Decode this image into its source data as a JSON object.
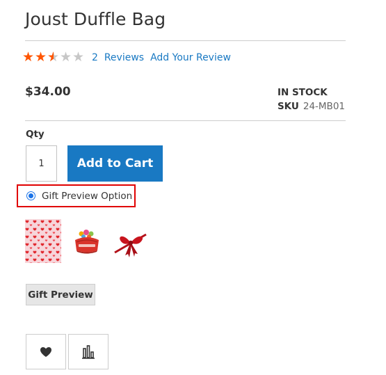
{
  "product": {
    "title": "Joust Duffle Bag",
    "price": "$34.00",
    "stock_status": "IN STOCK",
    "sku_label": "SKU",
    "sku_value": "24-MB01"
  },
  "rating": {
    "value": 2.5,
    "max": 5,
    "review_count_label": "2",
    "reviews_label": "Reviews",
    "add_review_label": "Add Your Review",
    "colors": {
      "filled": "#ff5501",
      "empty": "#c7c7c7",
      "link": "#1979c3"
    }
  },
  "purchase": {
    "qty_label": "Qty",
    "qty_value": "1",
    "add_to_cart_label": "Add to Cart",
    "button_color": "#1979c3"
  },
  "gift": {
    "option_label": "Gift Preview Option",
    "option_selected": true,
    "highlight_color": "#e00000",
    "thumbnails": [
      {
        "icon": "heart-pattern-wrap-icon"
      },
      {
        "icon": "red-gift-box-icon"
      },
      {
        "icon": "red-ribbon-bow-icon"
      }
    ],
    "preview_button_label": "Gift Preview"
  },
  "actions": [
    {
      "icon": "heart-icon"
    },
    {
      "icon": "compare-bars-icon"
    }
  ]
}
